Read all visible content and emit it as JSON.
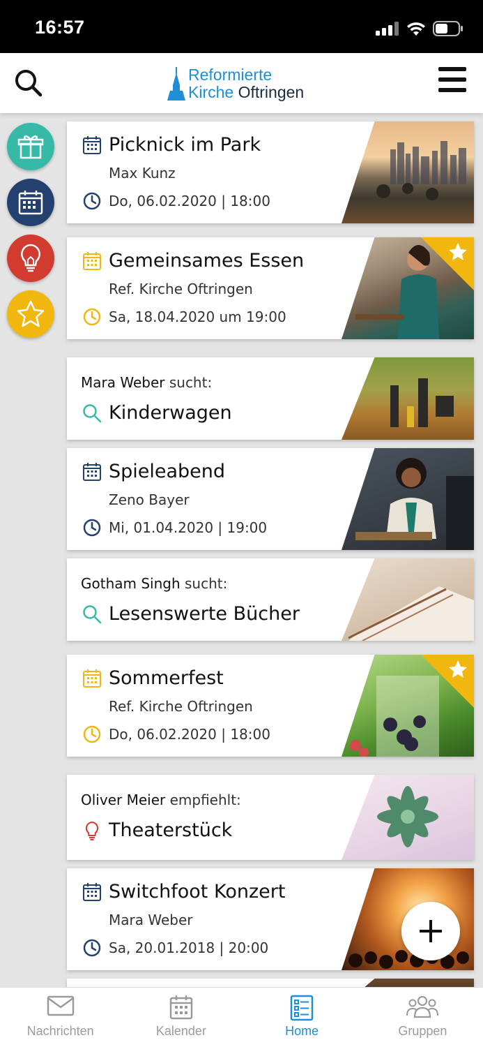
{
  "status_bar": {
    "time": "16:57"
  },
  "header": {
    "logo_line1": "Reformierte",
    "logo_line2a": "Kirche",
    "logo_line2b": "Oftringen"
  },
  "filters": [
    {
      "name": "gift-icon",
      "color": "#36b9a6"
    },
    {
      "name": "calendar-icon",
      "color": "#24406e"
    },
    {
      "name": "lightbulb-icon",
      "color": "#d23b2f"
    },
    {
      "name": "star-icon",
      "color": "#f2b70e"
    }
  ],
  "cards": [
    {
      "type": "event",
      "title": "Picknick im Park",
      "organizer": "Max Kunz",
      "date": "Do, 06.02.2020 | 18:00",
      "icon_color": "#24406e",
      "featured": false
    },
    {
      "type": "event",
      "title": "Gemeinsames Essen",
      "organizer": "Ref. Kirche Oftringen",
      "date": "Sa, 18.04.2020 um 19:00",
      "icon_color": "#f2b70e",
      "featured": true
    },
    {
      "type": "search",
      "user": "Mara Weber",
      "verb": "sucht:",
      "title": "Kinderwagen"
    },
    {
      "type": "event",
      "title": "Spieleabend",
      "organizer": "Zeno Bayer",
      "date": "Mi, 01.04.2020 | 19:00",
      "icon_color": "#24406e",
      "featured": false
    },
    {
      "type": "search",
      "user": "Gotham Singh",
      "verb": "sucht:",
      "title": "Lesenswerte Bücher"
    },
    {
      "type": "event",
      "title": "Sommerfest",
      "organizer": "Ref. Kirche Oftringen",
      "date": "Do, 06.02.2020 | 18:00",
      "icon_color": "#f2b70e",
      "featured": true
    },
    {
      "type": "recommend",
      "user": "Oliver Meier",
      "verb": "empfiehlt:",
      "title": "Theaterstück"
    },
    {
      "type": "event",
      "title": "Switchfoot Konzert",
      "organizer": "Mara Weber",
      "date": "Sa, 20.01.2018 | 20:00",
      "icon_color": "#24406e",
      "featured": false
    }
  ],
  "bottom_nav": [
    {
      "label": "Nachrichten",
      "icon": "mail-icon",
      "active": false
    },
    {
      "label": "Kalender",
      "icon": "calendar-icon",
      "active": false
    },
    {
      "label": "Home",
      "icon": "list-icon",
      "active": true
    },
    {
      "label": "Gruppen",
      "icon": "group-icon",
      "active": false
    }
  ],
  "colors": {
    "accent": "#1d8ed7",
    "navy": "#24406e",
    "yellow": "#f2b70e",
    "teal": "#36b9a6",
    "red": "#d23b2f"
  }
}
